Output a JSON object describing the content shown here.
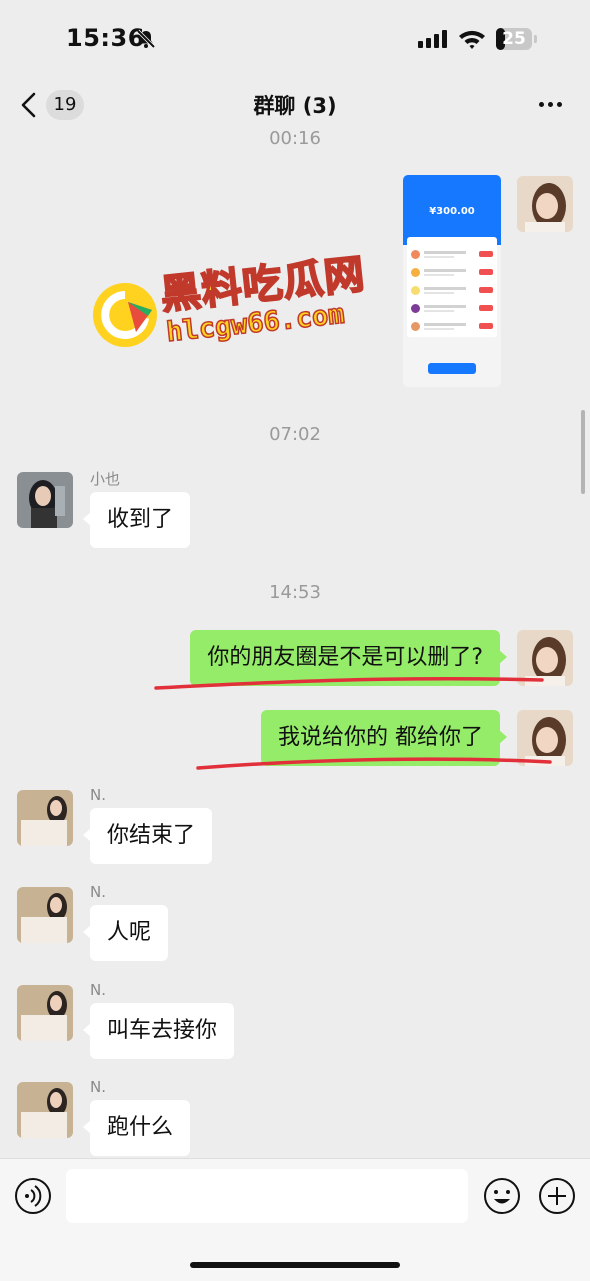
{
  "status_bar": {
    "time": "15:36",
    "battery": "25",
    "battery_level": 0.25,
    "icons": [
      "bell-muted-icon",
      "signal-icon",
      "wifi-icon",
      "battery-icon"
    ]
  },
  "nav": {
    "back_icon": "chevron-left-icon",
    "unread_count": "19",
    "title": "群聊 (3)",
    "more_icon": "more-dots-icon"
  },
  "chat": {
    "top_time": "00:16",
    "image_message": {
      "amount": "¥300.00",
      "accent_color": "#1677ff"
    },
    "watermark": {
      "text": "黑料吃瓜网",
      "url": "hlcgw66.com"
    },
    "time_1": "07:02",
    "sender_xiaoye": "小也",
    "msg_received": "收到了",
    "time_2": "14:53",
    "msg_out_1": "你的朋友圈是不是可以删了?",
    "msg_out_2": "我说给你的 都给你了",
    "sender_n": "N.",
    "msg_n_1": "你结束了",
    "msg_n_2": "人呢",
    "msg_n_3": "叫车去接你",
    "msg_n_4": "跑什么"
  },
  "colors": {
    "outgoing_bubble": "#95ec69",
    "incoming_bubble": "#ffffff",
    "background": "#ededed",
    "underline": "#e2303a"
  },
  "input_bar": {
    "placeholder": "",
    "voice_icon": "voice-icon",
    "emoji_icon": "emoji-icon",
    "add_icon": "plus-icon"
  }
}
